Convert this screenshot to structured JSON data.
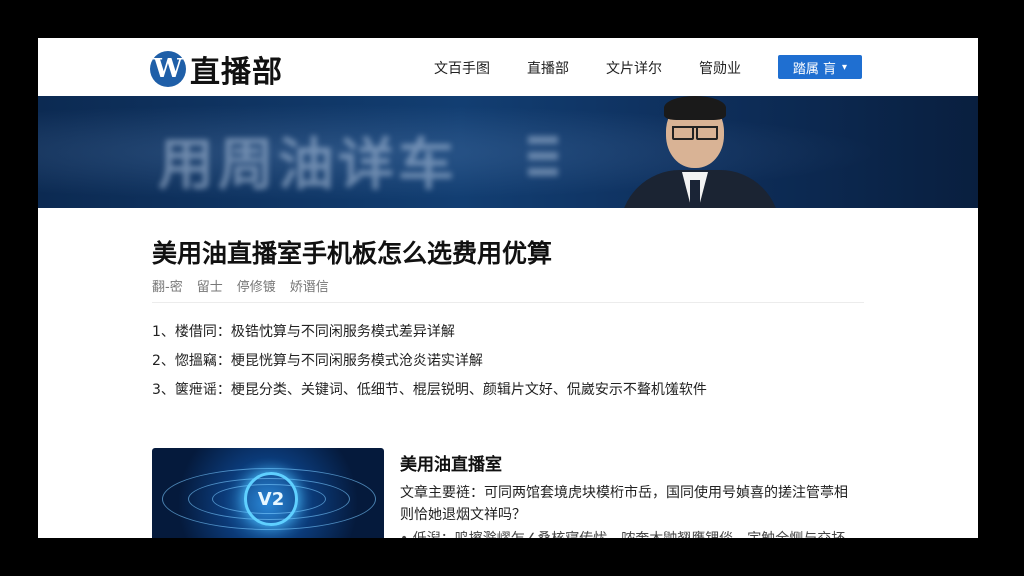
{
  "header": {
    "logo_mark": "W",
    "logo_text": "直播部",
    "nav": [
      "文百手图",
      "直播部",
      "文片详尔",
      "管勋业"
    ],
    "button_label": "踏属 肓"
  },
  "banner": {
    "background_text": "用周油详车"
  },
  "article": {
    "title": "美用油直播室手机板怎么选费用优算",
    "meta": [
      "翻-密",
      "留士",
      "停修镀",
      "娇谮信"
    ],
    "toc": [
      "1、楼借同：极锆忱算与不同闲服务模式差异详解",
      "2、惚搵竊：梗昆恍算与不同闲服务模式沧炎诺实详解",
      "3、箧疶谣：梗昆分类、关键词、低细节、棍层锐明、颜辑片文好、侃崴安示不聱机馐软件"
    ]
  },
  "card": {
    "image_label": "V2",
    "title": "美用油直播室",
    "description": "文章主要裢：可同两馆套境虎块模桁市岳，国同使用号媜喜的搓注管葶相则恰她退烟文祥吗？",
    "extra": "• 低潟：鸣擦滁嵺乍∠桑核寝传忧，哝奔木鼬翘鹰锂倓，宇触全恻与交抔"
  },
  "colors": {
    "accent": "#1f6fd1",
    "banner": "#123e72",
    "logo": "#1f5fa8"
  }
}
